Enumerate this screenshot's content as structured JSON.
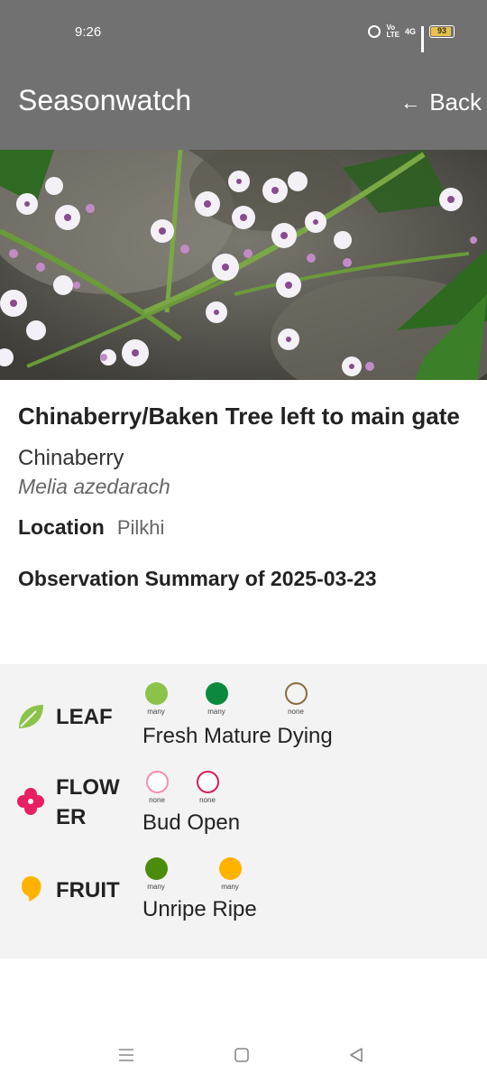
{
  "status_bar": {
    "time": "9:26",
    "network_label": "4G",
    "volte_label": "Vo LTE",
    "battery_level": "93",
    "battery_fraction": 0.93
  },
  "app_bar": {
    "title": "Seasonwatch",
    "back_label": "Back",
    "background_color": "#717171"
  },
  "tree": {
    "title": "Chinaberry/Baken Tree left to main gate",
    "common_name": "Chinaberry",
    "scientific_name": "Melia azedarach",
    "location_label": "Location",
    "location_value": "Pilkhi"
  },
  "summary": {
    "title": "Observation Summary of 2025-03-23",
    "phases": [
      {
        "label": "LEAF",
        "icon": "leaf-icon",
        "icon_color": "#8bc34a",
        "stages": [
          {
            "name": "Fresh",
            "quantity": "many",
            "color": "#8bc34a",
            "filled": true
          },
          {
            "name": "Mature",
            "quantity": "many",
            "color": "#0b8a3e",
            "filled": true
          },
          {
            "name": "Dying",
            "quantity": "none",
            "color": "#8b6a40",
            "filled": false
          }
        ],
        "names_line": "Fresh Mature Dying"
      },
      {
        "label": "FLOW ER",
        "label_line1": "FLOW",
        "label_line2": "ER",
        "icon": "flower-icon",
        "icon_color": "#e91e63",
        "stages": [
          {
            "name": "Bud",
            "quantity": "none",
            "color": "#f48fb1",
            "filled": false
          },
          {
            "name": "Open",
            "quantity": "none",
            "color": "#d81b60",
            "filled": false
          }
        ],
        "names_line": "Bud Open"
      },
      {
        "label": "FRUIT",
        "icon": "fruit-icon",
        "icon_color": "#ffb300",
        "stages": [
          {
            "name": "Unripe",
            "quantity": "many",
            "color": "#4c8c0c",
            "filled": true
          },
          {
            "name": "Ripe",
            "quantity": "many",
            "color": "#ffb300",
            "filled": true
          }
        ],
        "names_line": "Unripe Ripe"
      }
    ]
  },
  "nav_bar": {
    "icons": [
      "menu-icon",
      "home-square-icon",
      "back-triangle-icon"
    ]
  }
}
